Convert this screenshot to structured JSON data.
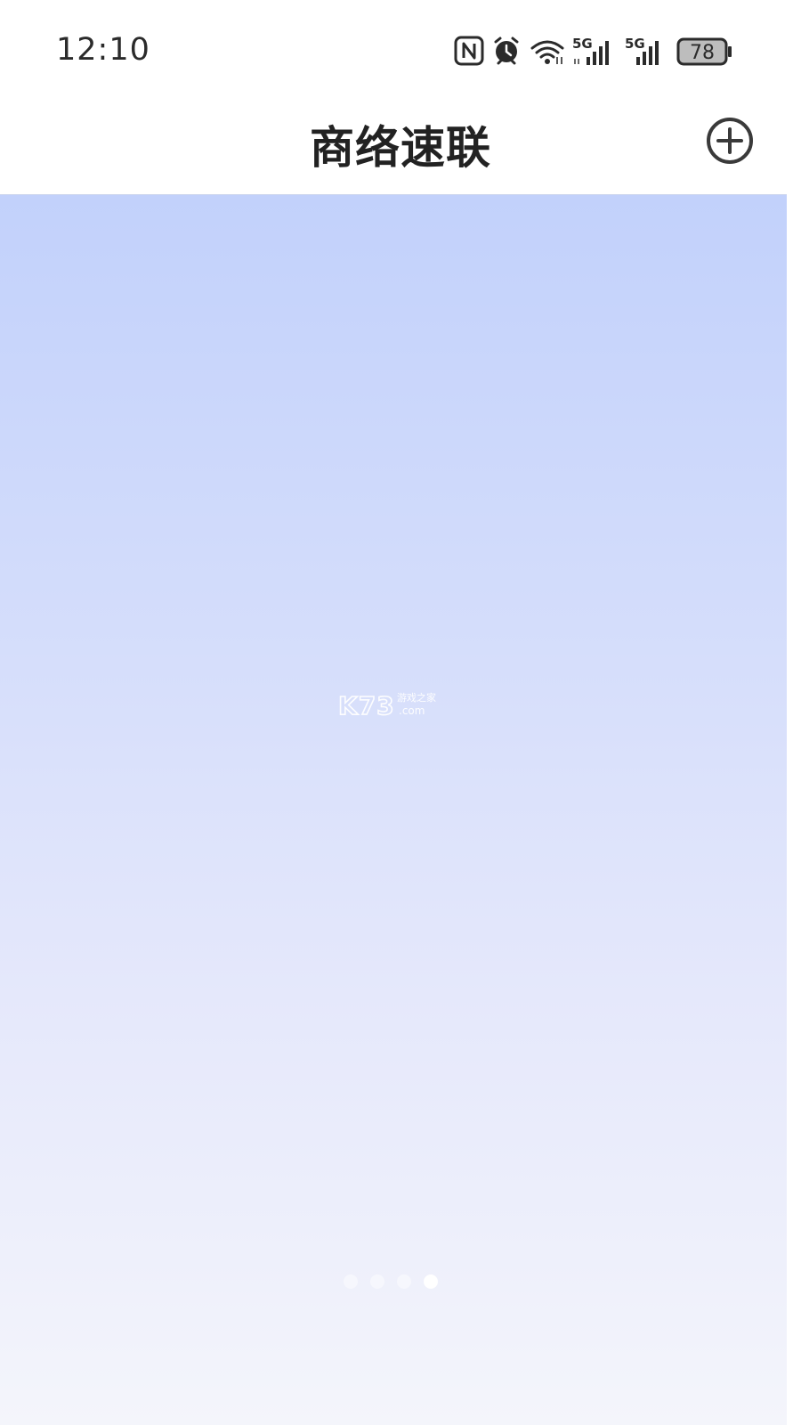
{
  "status_bar": {
    "time": "12:10",
    "network_1": "5G",
    "network_2": "5G",
    "battery": "78",
    "icons": [
      "nfc-icon",
      "alarm-icon",
      "wifi-icon",
      "signal-icon",
      "signal-icon",
      "battery-icon"
    ]
  },
  "header": {
    "title": "商络速联",
    "add_icon": "plus-circle-icon"
  },
  "carousel": {
    "watermark": {
      "main": "K73",
      "sub": "游戏之家",
      "domain": ".com"
    },
    "pages_total": 4,
    "active_page": 4,
    "colors": {
      "gradient_top": "#c2d1fb",
      "gradient_bottom": "#f4f5fb"
    }
  }
}
